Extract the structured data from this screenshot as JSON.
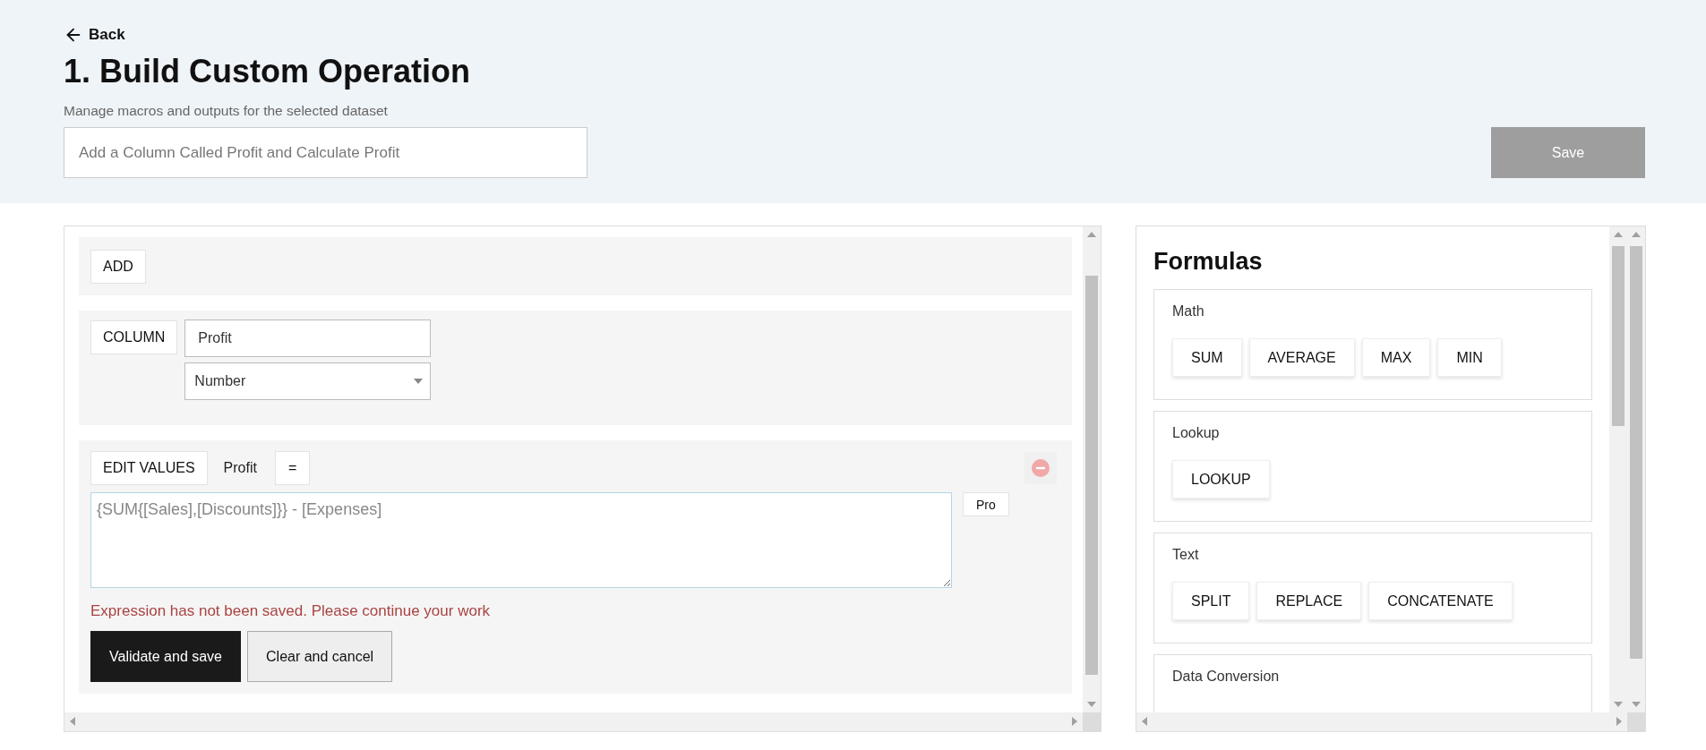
{
  "back": {
    "label": "Back"
  },
  "title": "1. Build Custom Operation",
  "subtitle": "Manage macros and outputs for the selected dataset",
  "operation_name": {
    "placeholder": "Add a Column Called Profit and Calculate Profit"
  },
  "save_button": {
    "label": "Save",
    "disabled": true
  },
  "steps": [
    {
      "kind": "add",
      "label": "ADD"
    },
    {
      "kind": "column",
      "label": "COLUMN",
      "name_value": "Profit",
      "type_value": "Number"
    },
    {
      "kind": "edit_values",
      "label": "EDIT VALUES",
      "target": "Profit",
      "operator": "=",
      "expression": "{SUM{[Sales],[Discounts]}} - [Expenses]",
      "side_button": "Pro",
      "message": "Expression has not been saved. Please continue your work",
      "primary": "Validate and save",
      "secondary": "Clear and cancel"
    }
  ],
  "formulas": {
    "title": "Formulas",
    "groups": [
      {
        "name": "Math",
        "functions": [
          "SUM",
          "AVERAGE",
          "MAX",
          "MIN"
        ]
      },
      {
        "name": "Lookup",
        "functions": [
          "LOOKUP"
        ]
      },
      {
        "name": "Text",
        "functions": [
          "SPLIT",
          "REPLACE",
          "CONCATENATE"
        ]
      },
      {
        "name": "Data Conversion"
      }
    ]
  }
}
